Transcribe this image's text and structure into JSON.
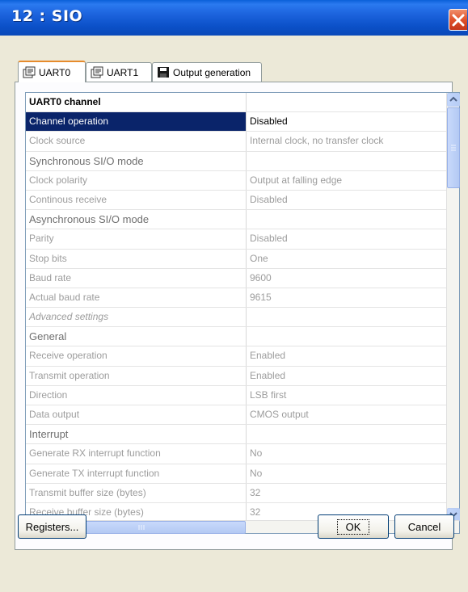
{
  "window": {
    "title": "12 : SIO"
  },
  "tabs": [
    {
      "label": "UART0",
      "icon": "property-sheet-icon",
      "active": true
    },
    {
      "label": "UART1",
      "icon": "property-sheet-icon",
      "active": false
    },
    {
      "label": "Output generation",
      "icon": "floppy-disk-icon",
      "active": false
    }
  ],
  "grid": {
    "rows": [
      {
        "label": "UART0 channel",
        "value": "",
        "type": "header"
      },
      {
        "label": "Channel operation",
        "value": "Disabled",
        "type": "selected"
      },
      {
        "label": "Clock source",
        "value": "Internal clock, no transfer clock",
        "type": "item"
      },
      {
        "label": "Synchronous SI/O mode",
        "value": "",
        "type": "section"
      },
      {
        "label": "Clock polarity",
        "value": "Output at falling edge",
        "type": "item"
      },
      {
        "label": "Continous receive",
        "value": "Disabled",
        "type": "item"
      },
      {
        "label": "Asynchronous SI/O mode",
        "value": "",
        "type": "section"
      },
      {
        "label": "Parity",
        "value": "Disabled",
        "type": "item"
      },
      {
        "label": "Stop bits",
        "value": "One",
        "type": "item"
      },
      {
        "label": "Baud rate",
        "value": "9600",
        "type": "item"
      },
      {
        "label": "Actual baud rate",
        "value": "9615",
        "type": "item"
      },
      {
        "label": "Advanced settings",
        "value": "",
        "type": "italic"
      },
      {
        "label": "General",
        "value": "",
        "type": "section"
      },
      {
        "label": "Receive operation",
        "value": "Enabled",
        "type": "item"
      },
      {
        "label": "Transmit operation",
        "value": "Enabled",
        "type": "item"
      },
      {
        "label": "Direction",
        "value": "LSB first",
        "type": "item"
      },
      {
        "label": "Data output",
        "value": "CMOS output",
        "type": "item"
      },
      {
        "label": "Interrupt",
        "value": "",
        "type": "section"
      },
      {
        "label": "Generate RX interrupt function",
        "value": "No",
        "type": "item"
      },
      {
        "label": "Generate TX interrupt function",
        "value": "No",
        "type": "item"
      },
      {
        "label": "Transmit buffer size (bytes)",
        "value": "32",
        "type": "item"
      },
      {
        "label": "Receive buffer size (bytes)",
        "value": "32",
        "type": "item"
      }
    ]
  },
  "buttons": {
    "registers": "Registers...",
    "ok": "OK",
    "cancel": "Cancel"
  },
  "colors": {
    "titlebar": "#0a5fd8",
    "selection": "#0a246a",
    "dialog": "#ece9d8",
    "close": "#e0522b"
  }
}
